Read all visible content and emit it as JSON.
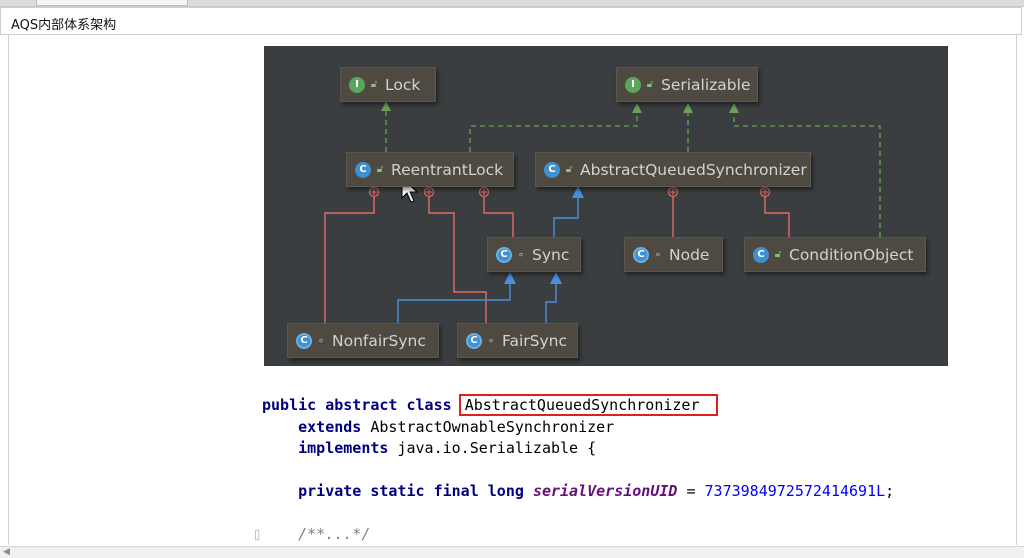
{
  "page": {
    "title": "AQS内部体系架构"
  },
  "diagram": {
    "nodes": {
      "lock": {
        "kind": "I",
        "label": "Lock"
      },
      "serializable": {
        "kind": "I",
        "label": "Serializable"
      },
      "reentrantlock": {
        "kind": "C",
        "label": "ReentrantLock"
      },
      "aqs": {
        "kind": "C",
        "label": "AbstractQueuedSynchronizer"
      },
      "sync": {
        "kind": "C",
        "label": "Sync"
      },
      "node": {
        "kind": "C",
        "label": "Node"
      },
      "conditionobject": {
        "kind": "C",
        "label": "ConditionObject"
      },
      "nonfairsync": {
        "kind": "C",
        "label": "NonfairSync"
      },
      "fairsync": {
        "kind": "C",
        "label": "FairSync"
      }
    }
  },
  "code": {
    "line1_kw": "public abstract class",
    "line1_name": "AbstractQueuedSynchronizer",
    "line2_kw": "extends",
    "line2_rest": "AbstractOwnableSynchronizer",
    "line3_kw": "implements",
    "line3_rest": "java.io.Serializable {",
    "line4_kw": "private static final long",
    "line4_field": "serialVersionUID",
    "line4_eq": " = ",
    "line4_num": "7373984972572414691L",
    "line4_end": ";",
    "line5_comment": "/**...*/"
  },
  "colors": {
    "diagram_bg": "#3b3e40",
    "node_bg": "#4e4a42",
    "realize": "#6aa05a",
    "inner": "#e06c66",
    "extends": "#4a8fdc",
    "highlight": "#e0201c"
  }
}
